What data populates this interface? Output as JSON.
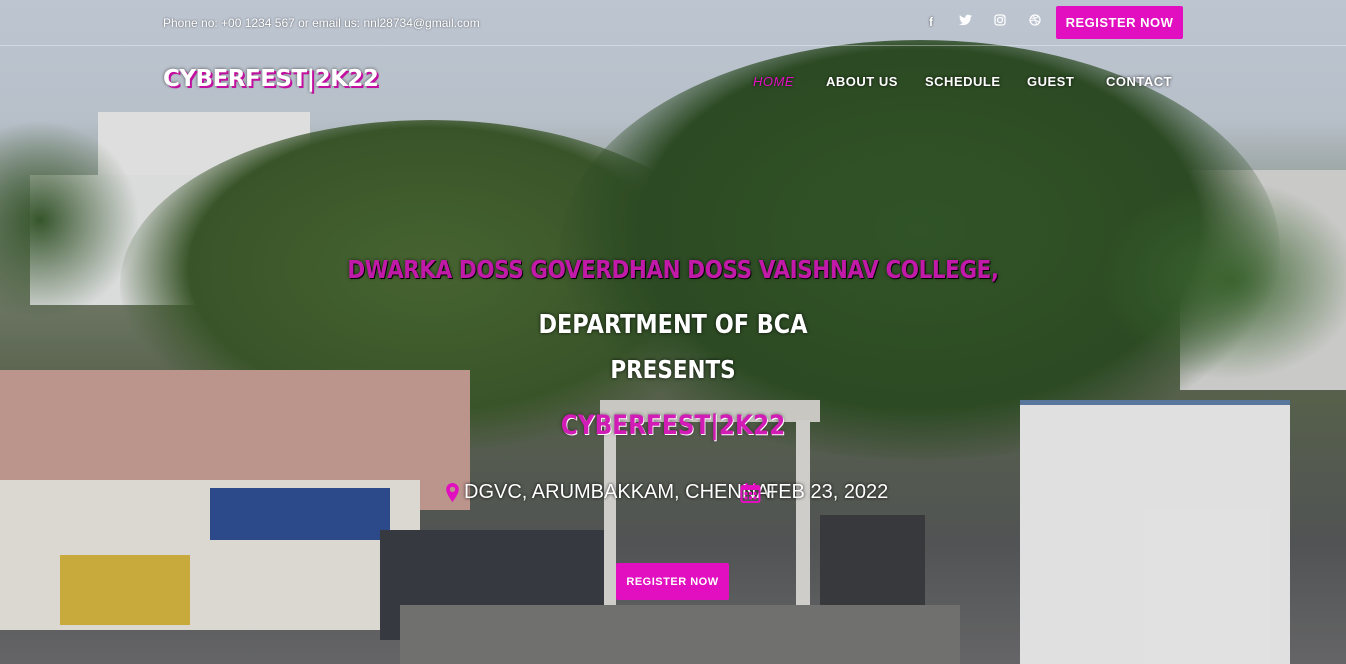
{
  "topbar": {
    "contact": "Phone no: +00 1234 567 or email us: nnl28734@gmail.com",
    "social_icons": [
      "facebook-icon",
      "twitter-icon",
      "instagram-icon",
      "dribbble-icon"
    ],
    "register_label": "REGISTER NOW"
  },
  "nav": {
    "brand": "CYBERFEST|2K22",
    "items": [
      {
        "label": "HOME",
        "active": true
      },
      {
        "label": "ABOUT US",
        "active": false
      },
      {
        "label": "SCHEDULE",
        "active": false
      },
      {
        "label": "GUEST",
        "active": false
      },
      {
        "label": "CONTACT",
        "active": false
      }
    ]
  },
  "hero": {
    "college": "DWARKA DOSS GOVERDHAN DOSS VAISHNAV COLLEGE,",
    "department": "DEPARTMENT OF BCA",
    "presents": "PRESENTS",
    "event": "CYBERFEST|2K22",
    "location": "DGVC, ARUMBAKKAM, CHENNAI",
    "date": "FEB 23, 2022",
    "register_label": "REGISTER NOW"
  },
  "colors": {
    "accent": "#e20fc0",
    "text": "#ffffff"
  }
}
